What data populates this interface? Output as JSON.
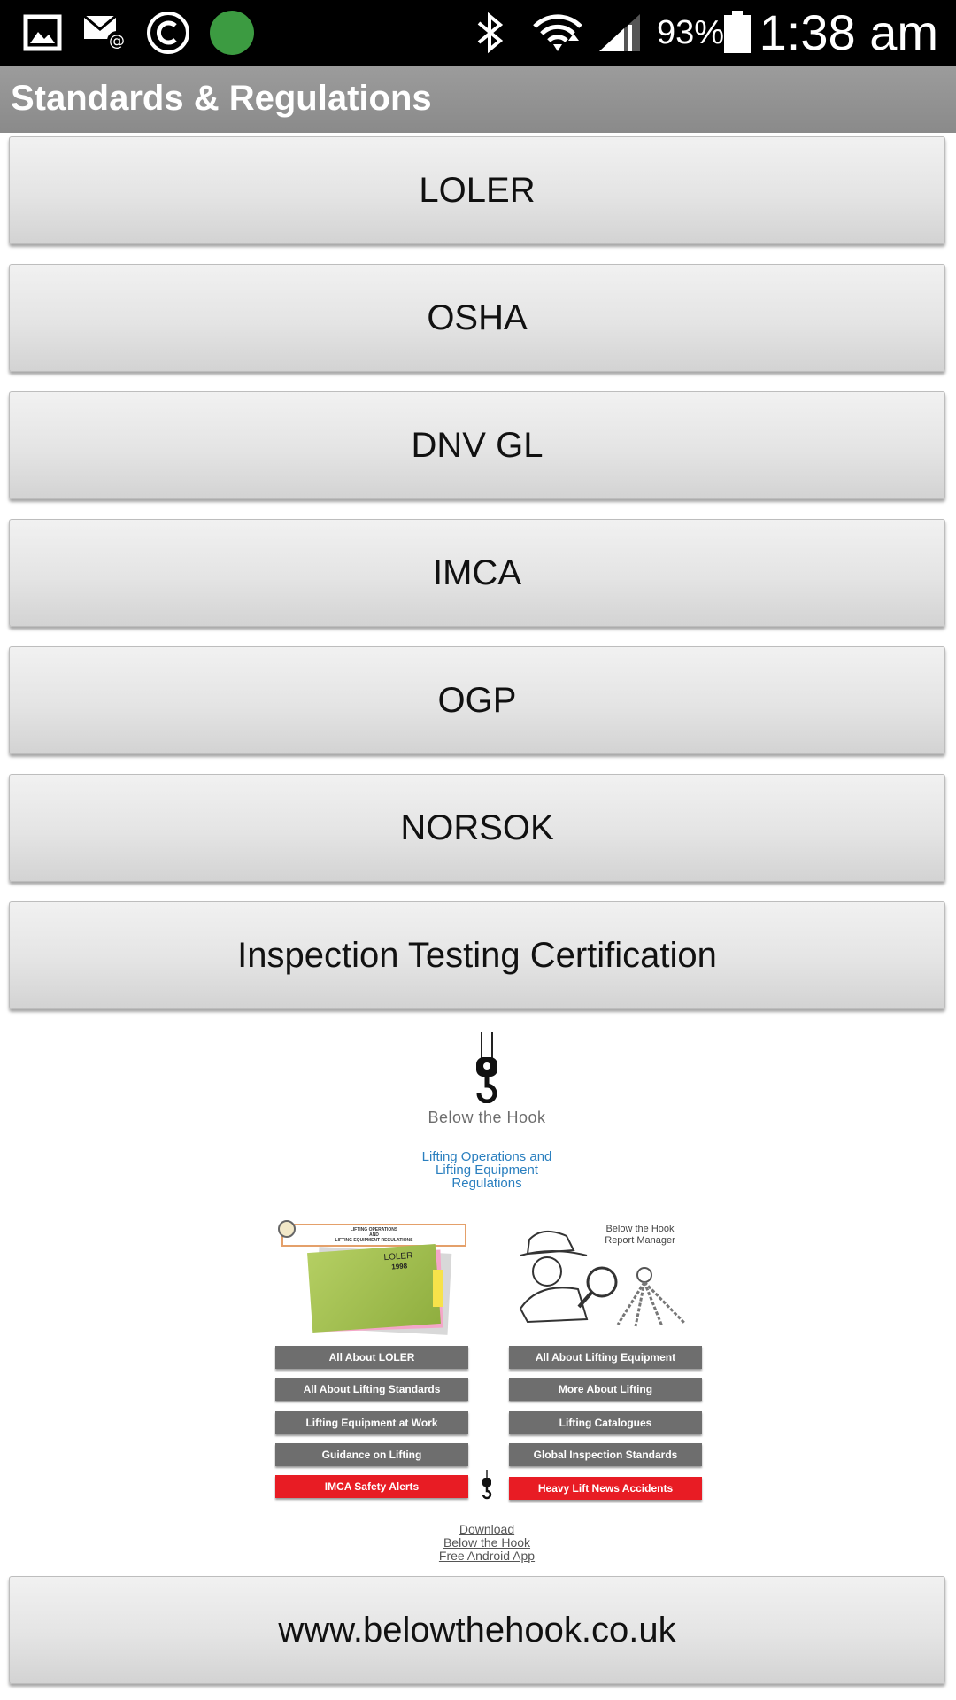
{
  "status_bar": {
    "battery_pct": "93%",
    "time": "1:38 am",
    "icons": [
      "gallery-icon",
      "mail-at-icon",
      "copyright-icon",
      "green-dot-icon",
      "bluetooth-icon",
      "wifi-icon",
      "signal-icon",
      "battery-icon"
    ]
  },
  "header": {
    "title": "Standards & Regulations"
  },
  "menu": {
    "items": [
      {
        "label": "LOLER"
      },
      {
        "label": "OSHA"
      },
      {
        "label": "DNV GL"
      },
      {
        "label": "IMCA"
      },
      {
        "label": "OGP"
      },
      {
        "label": "NORSOK"
      },
      {
        "label": "Inspection Testing Certification"
      }
    ]
  },
  "banner": {
    "brand": "Below the Hook",
    "heading_lines": [
      "Lifting Operations and",
      "Lifting Equipment",
      "Regulations"
    ],
    "report_manager": [
      "Below the Hook",
      "Report Manager"
    ],
    "document_lines": [
      "LIFTING OPERATIONS",
      "AND",
      "LIFTING EQUIPMENT REGULATIONS",
      "LOLER",
      "1998"
    ],
    "left_buttons": [
      "All About LOLER",
      "All About Lifting Standards",
      "Lifting Equipment at Work",
      "Guidance on Lifting",
      "IMCA Safety Alerts"
    ],
    "right_buttons": [
      "All About Lifting Equipment",
      "More About Lifting",
      "Lifting Catalogues",
      "Global Inspection Standards",
      "Heavy Lift News Accidents"
    ],
    "download_lines": [
      "Download",
      "Below the Hook",
      "Free Android App"
    ]
  },
  "footer": {
    "website_label": "www.belowthehook.co.uk"
  },
  "colors": {
    "status_bar": "#000000",
    "title_bar": "#939393",
    "button_face": "#e4e4e4",
    "banner_red": "#e81c24",
    "banner_gray": "#6e6e6e",
    "banner_blue": "#2a7fbf",
    "status_dot": "#3c9b41"
  }
}
